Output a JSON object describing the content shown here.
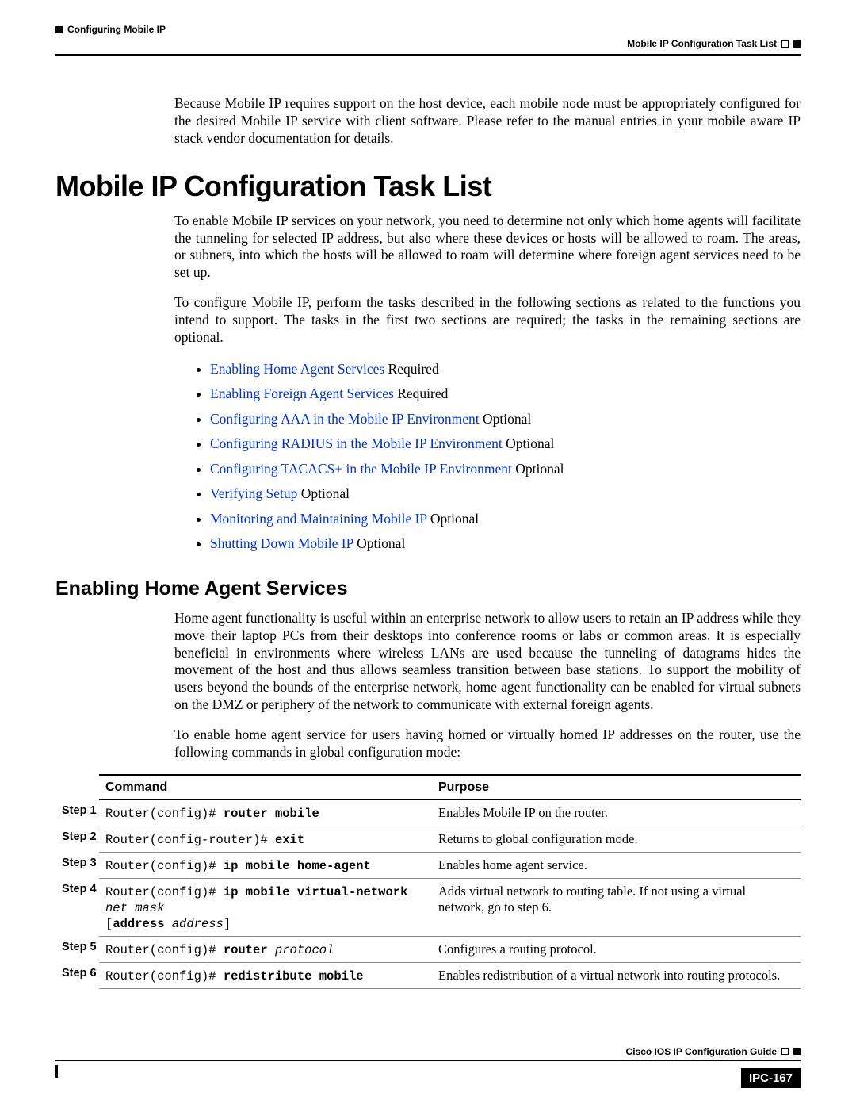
{
  "header": {
    "chapter": "Configuring Mobile IP",
    "section": "Mobile IP Configuration Task List"
  },
  "intro_para": "Because Mobile IP requires support on the host device, each mobile node must be appropriately configured for the desired Mobile IP service with client software. Please refer to the manual entries in your mobile aware IP stack vendor documentation for details.",
  "h1": "Mobile IP Configuration Task List",
  "p1": "To enable Mobile IP services on your network, you need to determine not only which home agents will facilitate the tunneling for selected IP address, but also where these devices or hosts will be allowed to roam. The areas, or subnets, into which the hosts will be allowed to roam will determine where foreign agent services need to be set up.",
  "p2": "To configure Mobile IP, perform the tasks described in the following sections as related to the functions you intend to support. The tasks in the first two sections are required; the tasks in the remaining sections are optional.",
  "tasks": [
    {
      "link": "Enabling Home Agent Services",
      "suffix": " Required"
    },
    {
      "link": "Enabling Foreign Agent Services",
      "suffix": " Required"
    },
    {
      "link": "Configuring AAA in the Mobile IP Environment",
      "suffix": " Optional"
    },
    {
      "link": "Configuring RADIUS in the Mobile IP Environment",
      "suffix": " Optional"
    },
    {
      "link": "Configuring TACACS+ in the Mobile IP Environment",
      "suffix": " Optional"
    },
    {
      "link": "Verifying Setup",
      "suffix": " Optional"
    },
    {
      "link": "Monitoring and Maintaining Mobile IP",
      "suffix": " Optional"
    },
    {
      "link": "Shutting Down Mobile IP",
      "suffix": " Optional"
    }
  ],
  "h2": "Enabling Home Agent Services",
  "p3": "Home agent functionality is useful within an enterprise network to allow users to retain an IP address while they move their laptop PCs from their desktops into conference rooms or labs or common areas. It is especially beneficial in environments where wireless LANs are used because the tunneling of datagrams hides the movement of the host and thus allows seamless transition between base stations. To support the mobility of users beyond the bounds of the enterprise network, home agent functionality can be enabled for virtual subnets on the DMZ or periphery of the network to communicate with external foreign agents.",
  "p4": "To enable home agent service for users having homed or virtually homed IP addresses on the router, use the following commands in global configuration mode:",
  "table": {
    "headers": [
      "Command",
      "Purpose"
    ],
    "rows": [
      {
        "step": "Step 1",
        "cmd_prefix": "Router(config)# ",
        "cmd_bold": "router mobile",
        "cmd_italic": "",
        "cmd_line2_bold": "",
        "cmd_line2_italic": "",
        "purpose": "Enables Mobile IP on the router."
      },
      {
        "step": "Step 2",
        "cmd_prefix": "Router(config-router)# ",
        "cmd_bold": "exit",
        "cmd_italic": "",
        "cmd_line2_bold": "",
        "cmd_line2_italic": "",
        "purpose": "Returns to global configuration mode."
      },
      {
        "step": "Step 3",
        "cmd_prefix": "Router(config)# ",
        "cmd_bold": "ip mobile home-agent",
        "cmd_italic": "",
        "cmd_line2_bold": "",
        "cmd_line2_italic": "",
        "purpose": "Enables home agent service."
      },
      {
        "step": "Step 4",
        "cmd_prefix": "Router(config)# ",
        "cmd_bold": "ip mobile virtual-network",
        "cmd_italic": " net mask",
        "cmd_line2_plain": "[",
        "cmd_line2_bold": "address",
        "cmd_line2_italic": " address",
        "cmd_line2_close": "]",
        "purpose": "Adds virtual network to routing table. If not using a virtual network, go to step 6."
      },
      {
        "step": "Step 5",
        "cmd_prefix": "Router(config)# ",
        "cmd_bold": "router",
        "cmd_italic": " protocol",
        "cmd_line2_bold": "",
        "cmd_line2_italic": "",
        "purpose": "Configures a routing protocol."
      },
      {
        "step": "Step 6",
        "cmd_prefix": "Router(config)# ",
        "cmd_bold": "redistribute mobile",
        "cmd_italic": "",
        "cmd_line2_bold": "",
        "cmd_line2_italic": "",
        "purpose": "Enables redistribution of a virtual network into routing protocols."
      }
    ]
  },
  "footer": {
    "guide": "Cisco IOS IP Configuration Guide",
    "page": "IPC-167"
  }
}
